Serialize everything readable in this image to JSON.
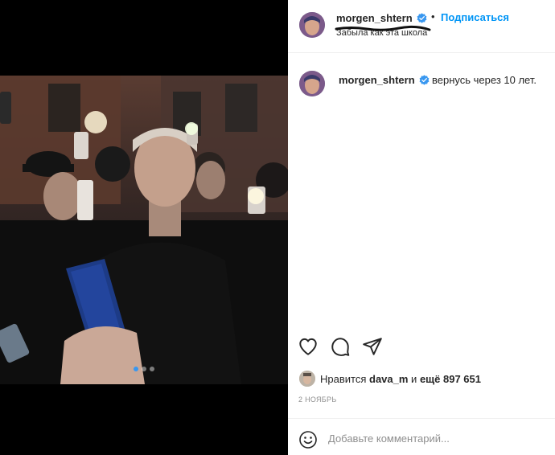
{
  "post": {
    "username": "morgen_shtern",
    "follow_label": "Подписаться",
    "separator": "•",
    "location": "Забыла как эта школа",
    "caption": "вернусь через 10 лет.",
    "carousel_count": 3,
    "carousel_active_index": 0
  },
  "actions": {
    "like_icon": "heart-icon",
    "comment_icon": "comment-icon",
    "share_icon": "share-icon"
  },
  "likes": {
    "prefix": "Нравится",
    "user": "dava_m",
    "conjunction": "и",
    "count": "ещё 897 651"
  },
  "date": "2 НОЯБРЬ",
  "comment": {
    "placeholder": "Добавьте комментарий...",
    "emoji_icon": "emoji-icon"
  },
  "colors": {
    "accent": "#0095f6",
    "verified": "#3897f0",
    "text": "#262626",
    "muted": "#8e8e8e"
  }
}
